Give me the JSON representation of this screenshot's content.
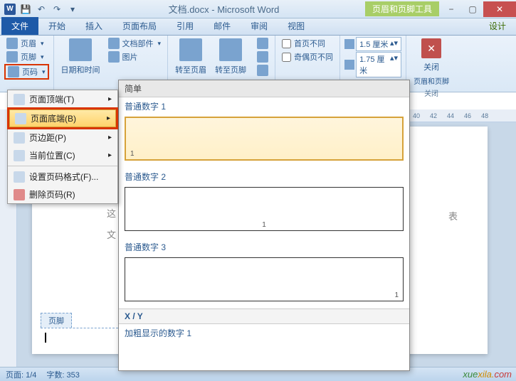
{
  "title": {
    "doc": "文档.docx",
    "app": "Microsoft Word",
    "context_tool": "页眉和页脚工具"
  },
  "win": {
    "min": "−",
    "max": "▢",
    "close": "✕"
  },
  "tabs": {
    "file": "文件",
    "t1": "开始",
    "t2": "插入",
    "t3": "页面布局",
    "t4": "引用",
    "t5": "邮件",
    "t6": "审阅",
    "t7": "视图",
    "design": "设计"
  },
  "ribbon": {
    "hf": {
      "yemei": "页眉",
      "yejiao": "页脚",
      "yema": "页码"
    },
    "datetime": "日期和时间",
    "parts": "文档部件",
    "pic": "图片",
    "goto": {
      "header": "转至页眉",
      "footer": "转至页脚"
    },
    "opts": {
      "first": "首页不同",
      "odd": "奇偶页不同"
    },
    "pos": {
      "top": "1.5 厘米",
      "bottom": "1.75 厘米"
    },
    "close": {
      "label": "关闭",
      "sub": "页眉和页脚",
      "group": "关闭"
    }
  },
  "menu": {
    "i1": "页面顶端(T)",
    "i2": "页面底端(B)",
    "i3": "页边距(P)",
    "i4": "当前位置(C)",
    "i5": "设置页码格式(F)...",
    "i6": "删除页码(R)"
  },
  "gallery": {
    "simple": "简单",
    "n1": "普通数字 1",
    "n2": "普通数字 2",
    "n3": "普通数字 3",
    "xy": "X / Y",
    "bold1": "加粗显示的数字 1"
  },
  "ruler": {
    "r1": "40",
    "r2": "42",
    "r3": "44",
    "r4": "46",
    "r5": "48"
  },
  "doc": {
    "footer_tab": "页脚",
    "frag1": "这",
    "frag2": "文",
    "frag3": "表"
  },
  "status": {
    "page": "页面: 1/4",
    "words": "字数: 353"
  },
  "watermark": {
    "a": "xue",
    "b": "xila.",
    "c": "com"
  }
}
